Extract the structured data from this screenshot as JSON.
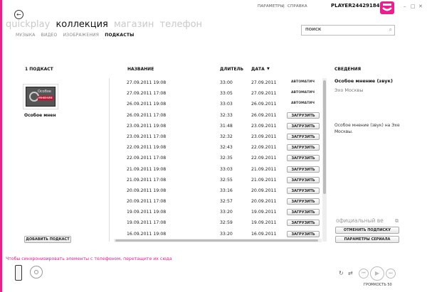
{
  "topbar": {
    "settings": "ПАРАМЕТРЫ",
    "separator": "|",
    "help": "СПРАВКА",
    "player": "PLAYER244291841",
    "minimize": "–",
    "restore": "□",
    "close": "✕"
  },
  "main_nav": [
    "quickplay",
    "коллекция",
    "магазин",
    "телефон"
  ],
  "sub_nav": [
    "МУЗЫКА",
    "ВИДЕО",
    "ИЗОБРАЖЕНИЯ",
    "ПОДКАСТЫ"
  ],
  "search": {
    "placeholder": "ПОИСК"
  },
  "left_panel": {
    "count": "1 ПОДКАСТ",
    "podcast_name": "Особое мнен",
    "thumb_line1": "Особое",
    "thumb_line2": "мнение",
    "add_button": "ДОБАВИТЬ ПОДКАСТ"
  },
  "columns": {
    "name": "НАЗВАНИЕ",
    "duration": "ДЛИТЕЛЬ",
    "date": "ДАТА",
    "sort_icon": "▼"
  },
  "episodes": [
    {
      "name": "27.09.2011 19:08",
      "duration": "33:00",
      "date": "27.09.2011",
      "action": "АВТОМАТИЧ",
      "is_button": false
    },
    {
      "name": "27.09.2011 17:08",
      "duration": "33:05",
      "date": "27.09.2011",
      "action": "АВТОМАТИЧ",
      "is_button": false
    },
    {
      "name": "26.09.2011 19:08",
      "duration": "33:03",
      "date": "26.09.2011",
      "action": "АВТОМАТИЧ",
      "is_button": false
    },
    {
      "name": "26.09.2011 17:08",
      "duration": "32:33",
      "date": "26.09.2011",
      "action": "ЗАГРУЗИТЬ",
      "is_button": true
    },
    {
      "name": "23.09.2011 19:08",
      "duration": "31:48",
      "date": "23.09.2011",
      "action": "ЗАГРУЗИТЬ",
      "is_button": true
    },
    {
      "name": "23.09.2011 17:08",
      "duration": "32:32",
      "date": "23.09.2011",
      "action": "ЗАГРУЗИТЬ",
      "is_button": true
    },
    {
      "name": "22.09.2011 19:08",
      "duration": "32:43",
      "date": "22.09.2011",
      "action": "ЗАГРУЗИТЬ",
      "is_button": true
    },
    {
      "name": "22.09.2011 17:08",
      "duration": "32:35",
      "date": "22.09.2011",
      "action": "ЗАГРУЗИТЬ",
      "is_button": true
    },
    {
      "name": "21.09.2011 19:08",
      "duration": "33:03",
      "date": "21.09.2011",
      "action": "ЗАГРУЗИТЬ",
      "is_button": true
    },
    {
      "name": "21.09.2011 17:08",
      "duration": "32:55",
      "date": "21.09.2011",
      "action": "ЗАГРУЗИТЬ",
      "is_button": true
    },
    {
      "name": "20.09.2011 19:08",
      "duration": "33:16",
      "date": "20.09.2011",
      "action": "ЗАГРУЗИТЬ",
      "is_button": true
    },
    {
      "name": "20.09.2011 17:08",
      "duration": "32:57",
      "date": "20.09.2011",
      "action": "ЗАГРУЗИТЬ",
      "is_button": true
    },
    {
      "name": "19.09.2011 19:08",
      "duration": "33:20",
      "date": "19.09.2011",
      "action": "ЗАГРУЗИТЬ",
      "is_button": true
    },
    {
      "name": "19.09.2011 17:08",
      "duration": "32:59",
      "date": "19.09.2011",
      "action": "ЗАГРУЗИТЬ",
      "is_button": true
    },
    {
      "name": "16.09.2011 19:08",
      "duration": "33:20",
      "date": "16.09.2011",
      "action": "ЗАГРУЗИТЬ",
      "is_button": true
    }
  ],
  "details": {
    "header": "СВЕДЕНИЯ",
    "title": "Особое мнение (звук)",
    "author": "Эхо Москвы",
    "description": "Особое мнение (звук)  на Эхе Москвы.",
    "official": "официальный ве",
    "unsubscribe": "ОТМЕНИТЬ ПОДПИСКУ",
    "series_settings": "ПАРАМЕТРЫ СЕРИАЛА"
  },
  "footer": {
    "sync_message": "Чтобы синхронизировать элементы с телефоном, перетащите их сюда",
    "volume": "ГРОМКОСТЬ 50",
    "icons": {
      "repeat": "↻",
      "shuffle": "⇄",
      "prev": "⏮",
      "play": "▶",
      "next": "⏭"
    }
  },
  "colors": {
    "accent": "#ec1e8c"
  }
}
